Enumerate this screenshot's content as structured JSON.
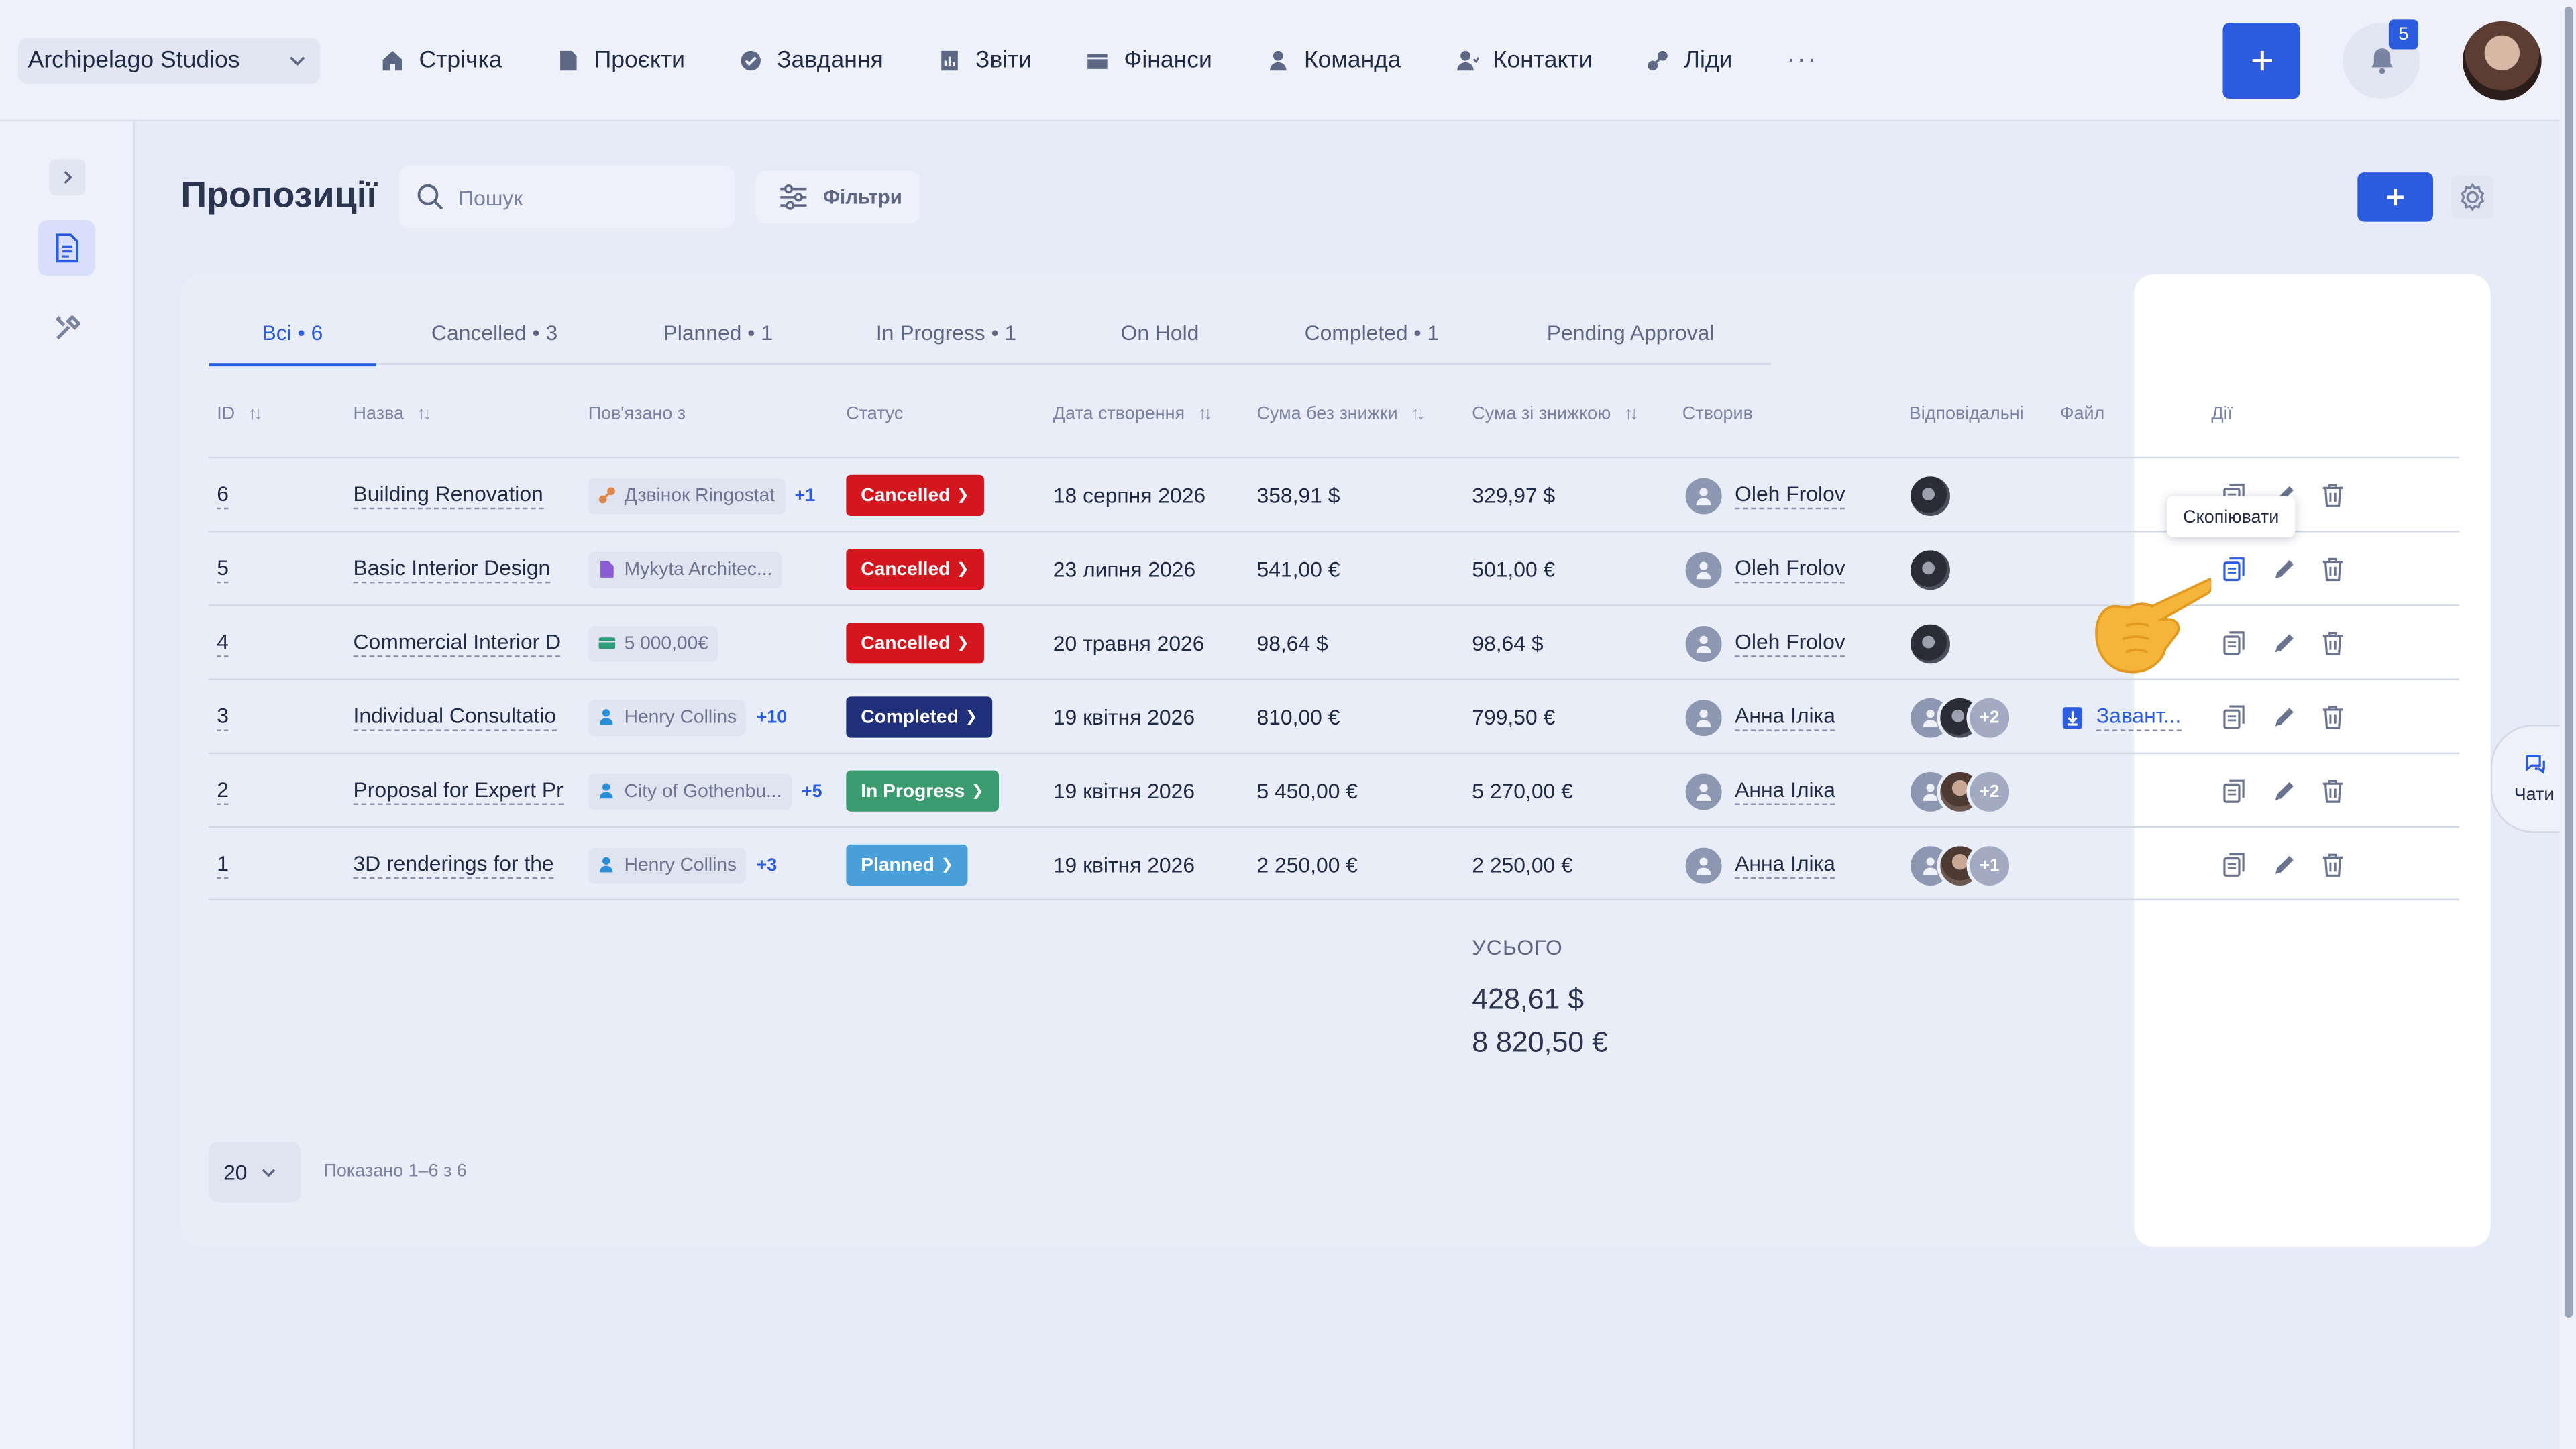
{
  "workspace": {
    "name": "Archipelago Studios"
  },
  "nav": [
    {
      "label": "Стрічка",
      "icon": "home-icon"
    },
    {
      "label": "Проєкти",
      "icon": "document-icon"
    },
    {
      "label": "Завдання",
      "icon": "check-circle-icon"
    },
    {
      "label": "Звіти",
      "icon": "chart-icon"
    },
    {
      "label": "Фінанси",
      "icon": "wallet-icon"
    },
    {
      "label": "Команда",
      "icon": "user-icon"
    },
    {
      "label": "Контакти",
      "icon": "contacts-icon"
    },
    {
      "label": "Ліди",
      "icon": "leads-icon"
    }
  ],
  "nav_more": "···",
  "notifications": {
    "count": "5"
  },
  "page": {
    "title": "Пропозиції",
    "search_placeholder": "Пошук",
    "filters_label": "Фільтри"
  },
  "tabs": [
    {
      "label": "Всі • 6",
      "active": true
    },
    {
      "label": "Cancelled • 3"
    },
    {
      "label": "Planned • 1"
    },
    {
      "label": "In Progress • 1"
    },
    {
      "label": "On Hold"
    },
    {
      "label": "Completed • 1"
    },
    {
      "label": "Pending Approval"
    }
  ],
  "columns": {
    "id": "ID",
    "name": "Назва",
    "related": "Пов'язано з",
    "status": "Статус",
    "created_date": "Дата створення",
    "sum": "Сума без знижки",
    "sum_discount": "Сума зі знижкою",
    "creator": "Створив",
    "responsible": "Відповідальні",
    "file": "Файл",
    "actions": "Дії"
  },
  "rows": [
    {
      "id": "6",
      "name": "Building Renovation",
      "related": "Дзвінок Ringostat",
      "related_more": "+1",
      "status": "Cancelled",
      "date": "18 серпня 2026",
      "sum": "358,91 $",
      "sum_discount": "329,97 $",
      "creator": "Oleh Frolov",
      "resp_more": "",
      "file": ""
    },
    {
      "id": "5",
      "name": "Basic Interior Design",
      "related": "Mykyta Architec...",
      "related_more": "",
      "status": "Cancelled",
      "date": "23 липня 2026",
      "sum": "541,00 €",
      "sum_discount": "501,00 €",
      "creator": "Oleh Frolov",
      "resp_more": "",
      "file": ""
    },
    {
      "id": "4",
      "name": "Commercial Interior D",
      "related": "5 000,00€",
      "related_more": "",
      "status": "Cancelled",
      "date": "20 травня 2026",
      "sum": "98,64 $",
      "sum_discount": "98,64 $",
      "creator": "Oleh Frolov",
      "resp_more": "",
      "file": ""
    },
    {
      "id": "3",
      "name": "Individual Consultatio",
      "related": "Henry Collins",
      "related_more": "+10",
      "status": "Completed",
      "date": "19 квітня 2026",
      "sum": "810,00 €",
      "sum_discount": "799,50 €",
      "creator": "Анна Іліка",
      "resp_more": "+2",
      "file": "Завант..."
    },
    {
      "id": "2",
      "name": "Proposal for Expert Pr",
      "related": "City of Gothenbu...",
      "related_more": "+5",
      "status": "In Progress",
      "date": "19 квітня 2026",
      "sum": "5 450,00 €",
      "sum_discount": "5 270,00 €",
      "creator": "Анна Іліка",
      "resp_more": "+2",
      "file": ""
    },
    {
      "id": "1",
      "name": "3D renderings for the",
      "related": "Henry Collins",
      "related_more": "+3",
      "status": "Planned",
      "date": "19 квітня 2026",
      "sum": "2 250,00 €",
      "sum_discount": "2 250,00 €",
      "creator": "Анна Іліка",
      "resp_more": "+1",
      "file": ""
    }
  ],
  "tooltip": "Скопіювати",
  "totals": {
    "label": "УСЬОГО",
    "usd": "428,61 $",
    "eur": "8 820,50 €"
  },
  "pagination": {
    "page_size": "20",
    "info": "Показано 1–6 з 6"
  },
  "chat": {
    "label": "Чати"
  },
  "colors": {
    "accent": "#2b5ce0",
    "cancelled": "#d4161e",
    "completed": "#1f2f7a",
    "in_progress": "#3a9b6f",
    "planned": "#4a9fd8"
  }
}
